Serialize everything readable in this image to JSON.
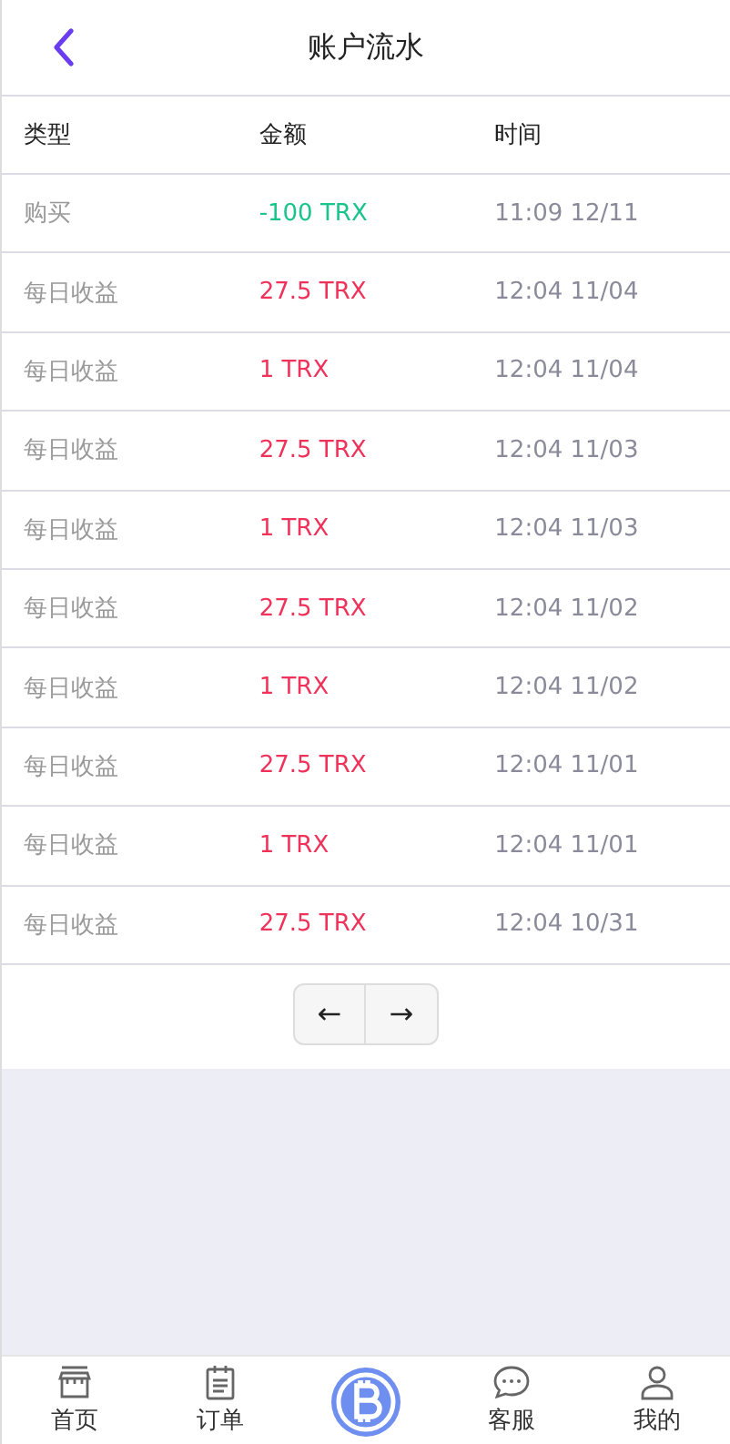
{
  "header": {
    "title": "账户流水"
  },
  "table": {
    "columns": [
      "类型",
      "金额",
      "时间"
    ],
    "rows": [
      {
        "kind": "purchase",
        "type": "购买",
        "amount": "-100 TRX",
        "time": "11:09 12/11"
      },
      {
        "kind": "income",
        "type": "每日收益",
        "amount": "27.5 TRX",
        "time": "12:04 11/04"
      },
      {
        "kind": "income",
        "type": "每日收益",
        "amount": "1 TRX",
        "time": "12:04 11/04"
      },
      {
        "kind": "income",
        "type": "每日收益",
        "amount": "27.5 TRX",
        "time": "12:04 11/03"
      },
      {
        "kind": "income",
        "type": "每日收益",
        "amount": "1 TRX",
        "time": "12:04 11/03"
      },
      {
        "kind": "income",
        "type": "每日收益",
        "amount": "27.5 TRX",
        "time": "12:04 11/02"
      },
      {
        "kind": "income",
        "type": "每日收益",
        "amount": "1 TRX",
        "time": "12:04 11/02"
      },
      {
        "kind": "income",
        "type": "每日收益",
        "amount": "27.5 TRX",
        "time": "12:04 11/01"
      },
      {
        "kind": "income",
        "type": "每日收益",
        "amount": "1 TRX",
        "time": "12:04 11/01"
      },
      {
        "kind": "income",
        "type": "每日收益",
        "amount": "27.5 TRX",
        "time": "12:04 10/31"
      }
    ]
  },
  "pagination": {
    "prev": "←",
    "next": "→"
  },
  "tab_bar": [
    {
      "kind": "home",
      "label": "首页"
    },
    {
      "kind": "orders",
      "label": "订单"
    },
    {
      "kind": "coin"
    },
    {
      "kind": "service",
      "label": "客服"
    },
    {
      "kind": "profile",
      "label": "我的"
    }
  ]
}
